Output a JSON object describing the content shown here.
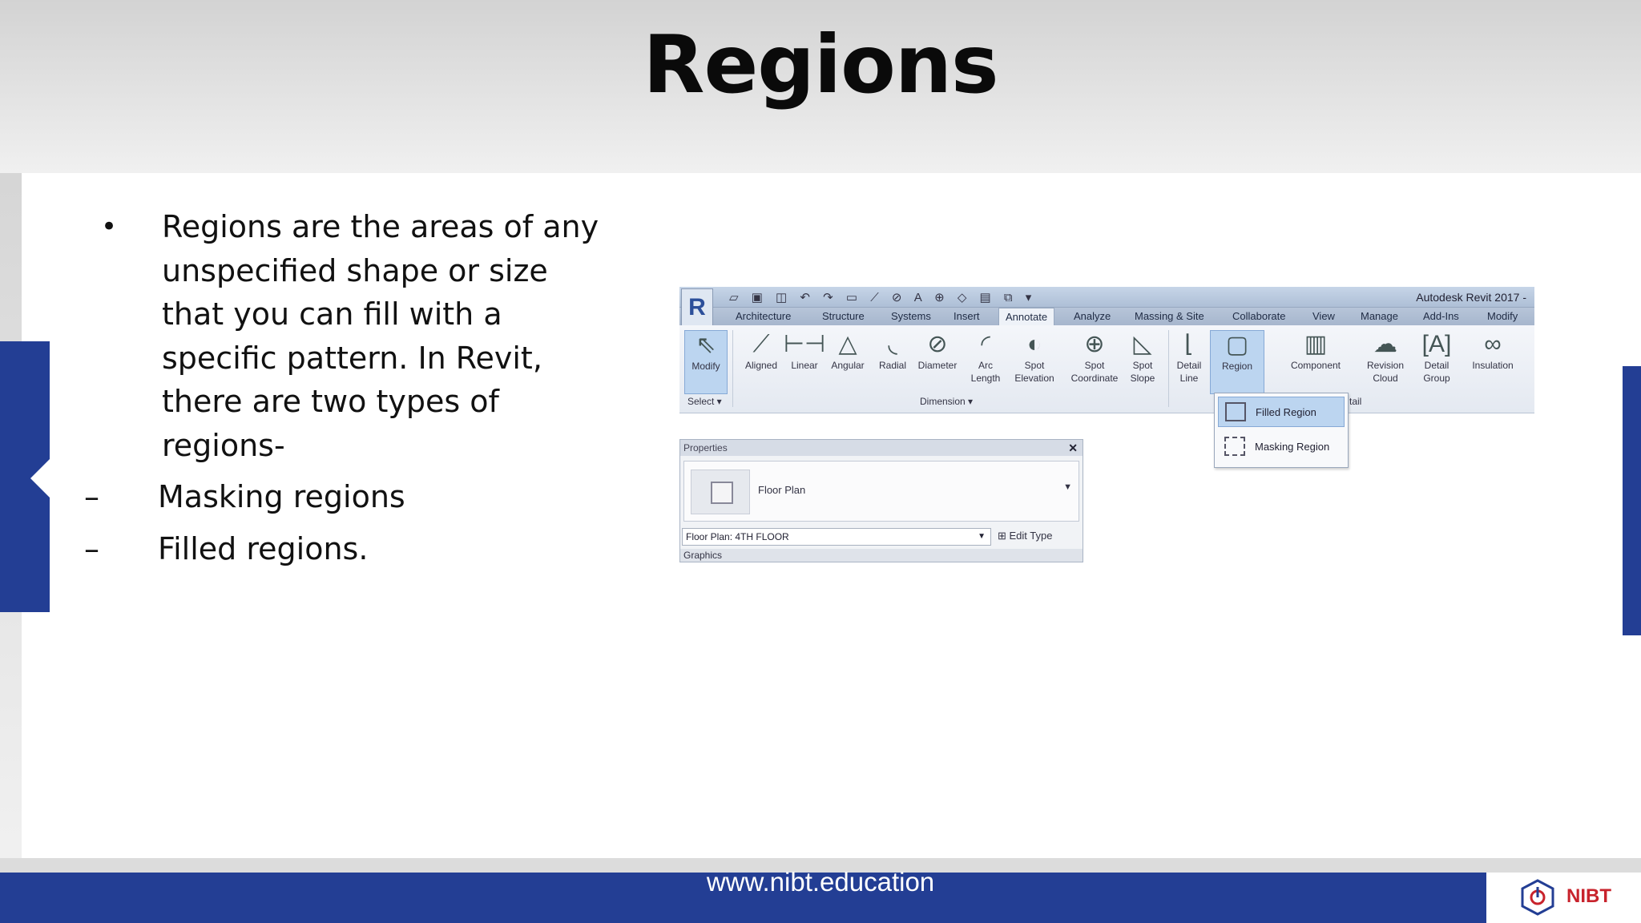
{
  "slide": {
    "title": "Regions",
    "bullet": "Regions are the areas of any unspecified shape or size that you can fill with a specific pattern. In Revit, there are two types of regions-",
    "sub_items": [
      "Masking regions",
      "Filled regions."
    ],
    "footer_url": "www.nibt.education",
    "logo_text": "NIBT"
  },
  "revit": {
    "logo": "R",
    "app_title": "Autodesk Revit 2017 -",
    "tabs": [
      "Architecture",
      "Structure",
      "Systems",
      "Insert",
      "Annotate",
      "Analyze",
      "Massing & Site",
      "Collaborate",
      "View",
      "Manage",
      "Add-Ins",
      "Modify"
    ],
    "active_tab": "Annotate",
    "tools": {
      "modify": "Modify",
      "aligned": "Aligned",
      "linear": "Linear",
      "angular": "Angular",
      "radial": "Radial",
      "diameter": "Diameter",
      "arc_length": "Arc Length",
      "spot_elevation": "Spot Elevation",
      "spot_coordinate": "Spot Coordinate",
      "spot_slope": "Spot Slope",
      "detail_line": "Detail Line",
      "region": "Region",
      "component": "Component",
      "revision_cloud": "Revision Cloud",
      "detail_group": "Detail Group",
      "insulation": "Insulation"
    },
    "groups": {
      "select": "Select ▾",
      "dimension": "Dimension ▾",
      "detail": "tail"
    },
    "dropdown": {
      "filled": "Filled Region",
      "masking": "Masking Region"
    },
    "properties": {
      "header": "Properties",
      "close": "✕",
      "type": "Floor Plan",
      "instance": "Floor Plan: 4TH FLOOR",
      "edit_type": "Edit Type",
      "graphics": "Graphics"
    }
  },
  "colors": {
    "brand_blue": "#233e94",
    "logo_red": "#c8232c"
  }
}
